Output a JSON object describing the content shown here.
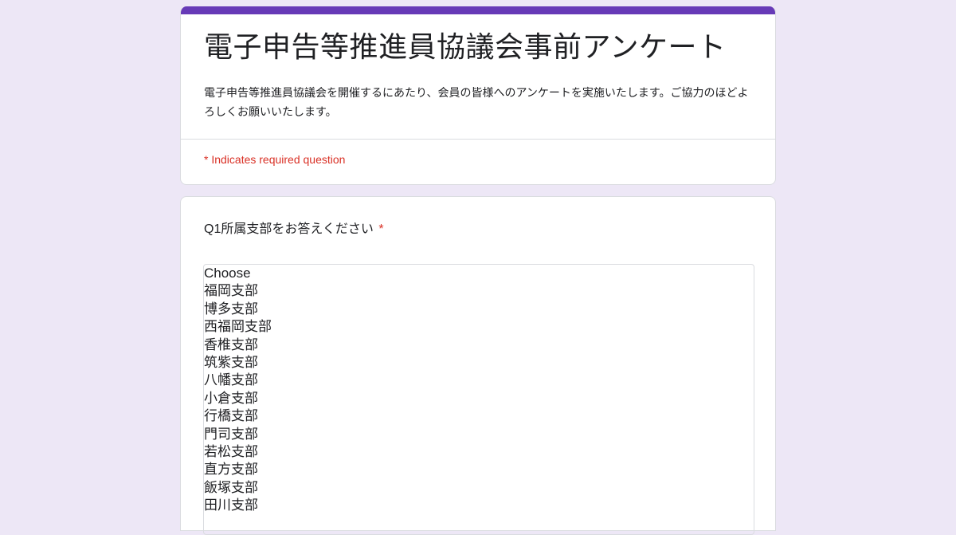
{
  "form": {
    "title": "電子申告等推進員協議会事前アンケート",
    "description": "電子申告等推進員協議会を開催するにあたり、会員の皆様へのアンケートを実施いたします。ご協力のほどよろしくお願いいたします。",
    "required_note": "* Indicates required question",
    "accent_color": "#673ab7"
  },
  "question1": {
    "title": "Q1所属支部をお答えください",
    "required_marker": "*",
    "options": [
      "Choose",
      "福岡支部",
      "博多支部",
      "西福岡支部",
      "香椎支部",
      "筑紫支部",
      "八幡支部",
      "小倉支部",
      "行橋支部",
      "門司支部",
      "若松支部",
      "直方支部",
      "飯塚支部",
      "田川支部"
    ]
  }
}
